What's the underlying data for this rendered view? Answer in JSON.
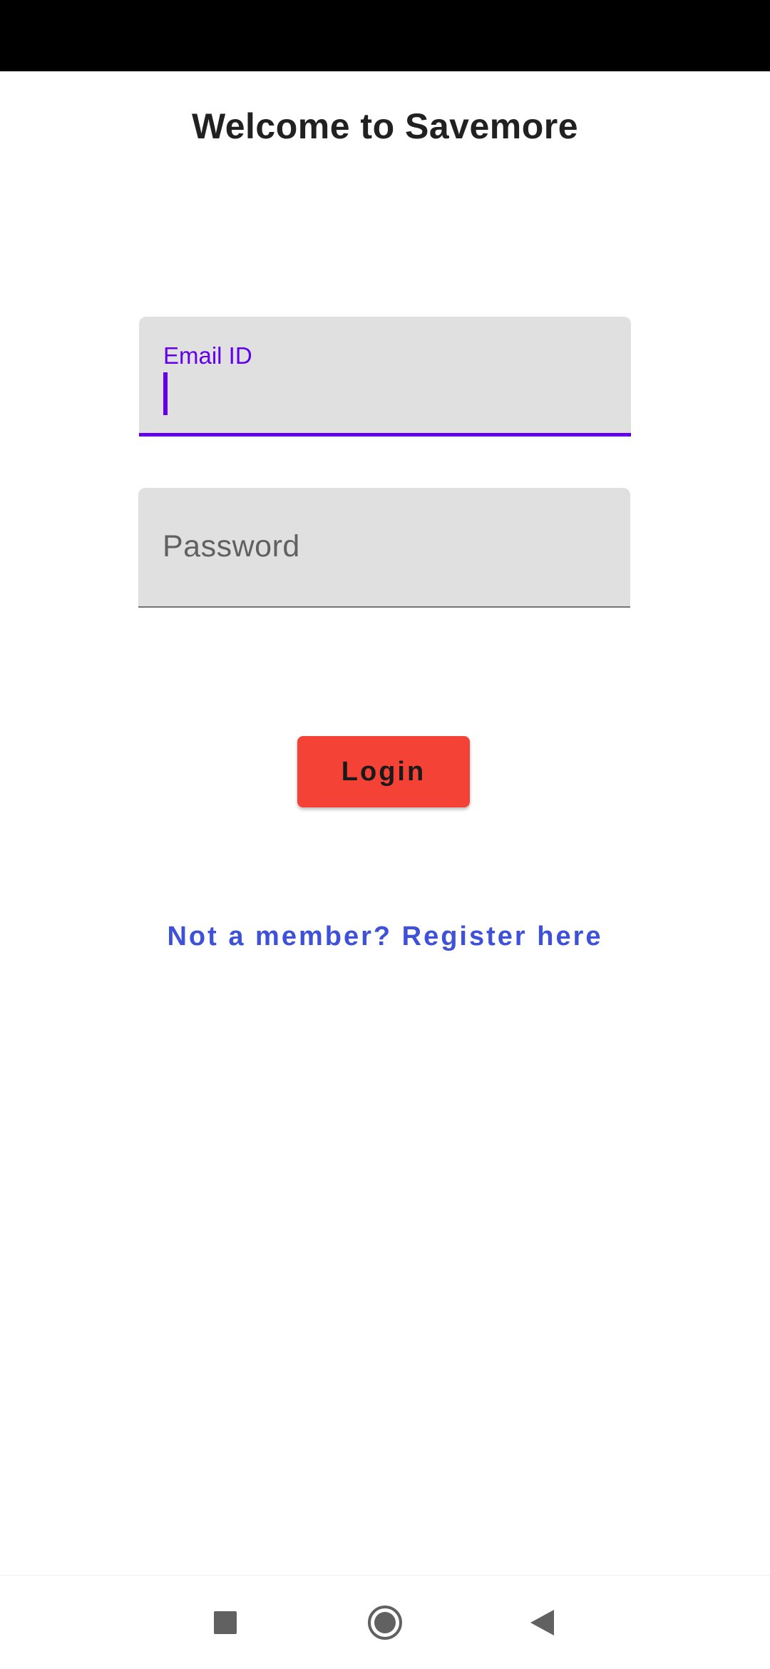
{
  "header": {
    "title": "Welcome to Savemore"
  },
  "form": {
    "email": {
      "label": "Email ID",
      "value": ""
    },
    "password": {
      "placeholder": "Password",
      "value": ""
    },
    "login_label": "Login",
    "register_link": "Not a member? Register here"
  },
  "colors": {
    "accent": "#6200ee",
    "login_button": "#f44336",
    "link": "#3f51d9"
  },
  "nav": {
    "icons": [
      "recents-icon",
      "home-icon",
      "back-icon"
    ]
  }
}
